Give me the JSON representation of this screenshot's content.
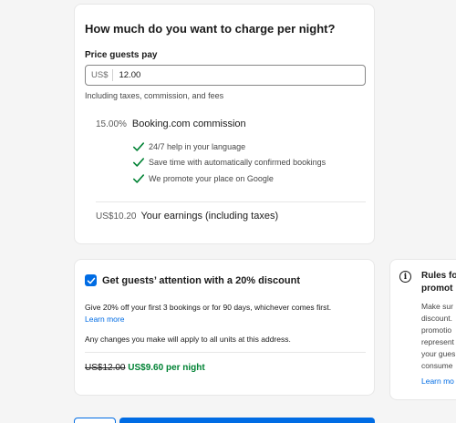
{
  "price_section": {
    "question": "How much do you want to charge per night?",
    "field_label": "Price guests pay",
    "currency": "US$",
    "amount": "12.00",
    "hint": "Including taxes, commission, and fees",
    "commission_pct": "15.00%",
    "commission_label": "Booking.com commission",
    "benefits": [
      "24/7 help in your language",
      "Save time with automatically confirmed bookings",
      "We promote your place on Google"
    ],
    "earnings_value": "US$10.20",
    "earnings_label": "Your earnings (including taxes)"
  },
  "discount_section": {
    "checked": true,
    "title": "Get guests’ attention with a 20% discount",
    "description": "Give 20% off your first 3 bookings or for 90 days, whichever comes first.",
    "learn_more": "Learn more",
    "note": "Any changes you make will apply to all units at this address.",
    "old_price": "US$12.00",
    "new_price": "US$9.60 per night"
  },
  "rules_section": {
    "title_lines": [
      "Rules fo",
      "promot"
    ],
    "body_lines": [
      "Make sur",
      "discount.",
      "promotio",
      "represent",
      "your gues",
      "consume"
    ],
    "learn_more": "Learn mo"
  },
  "colors": {
    "accent": "#006ce4",
    "success": "#008234"
  }
}
